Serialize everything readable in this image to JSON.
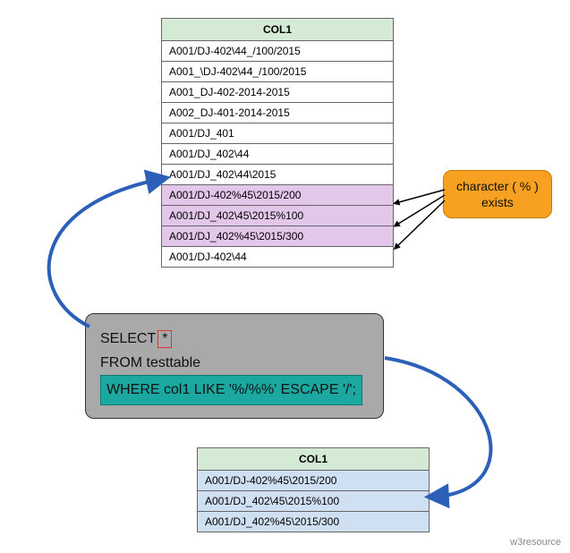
{
  "top_table": {
    "header": "COL1",
    "rows": [
      "A001/DJ-402\\44_/100/2015",
      "A001_\\DJ-402\\44_/100/2015",
      "A001_DJ-402-2014-2015",
      "A002_DJ-401-2014-2015",
      "A001/DJ_401",
      "A001/DJ_402\\44",
      "A001/DJ_402\\44\\2015",
      "A001/DJ-402%45\\2015/200",
      "A001/DJ_402\\45\\2015%100",
      "A001/DJ_402%45\\2015/300",
      "A001/DJ-402\\44"
    ],
    "highlight_indices": [
      7,
      8,
      9
    ]
  },
  "sql": {
    "select_kw": "SELECT",
    "asterisk": "*",
    "from_line": "FROM testtable",
    "where_line": "WHERE col1   LIKE '%/%%' ESCAPE '/';"
  },
  "callout": {
    "line1": "character ( % )",
    "line2": "exists"
  },
  "result_table": {
    "header": "COL1",
    "rows": [
      "A001/DJ-402%45\\2015/200",
      "A001/DJ_402\\45\\2015%100",
      "A001/DJ_402%45\\2015/300"
    ]
  },
  "attribution": "w3resource"
}
